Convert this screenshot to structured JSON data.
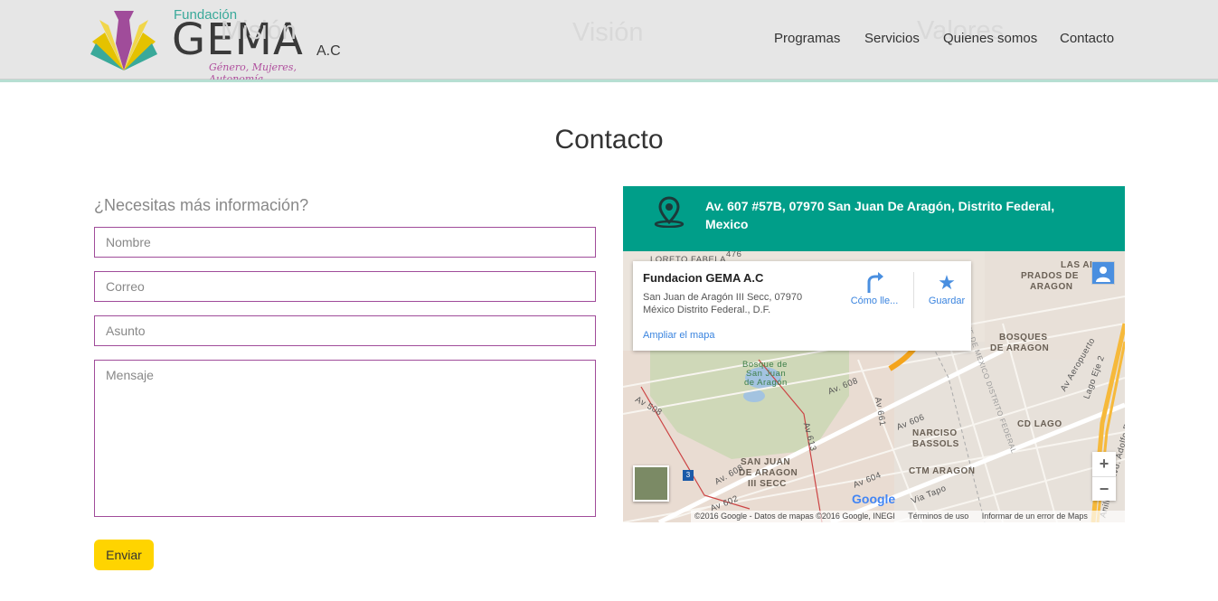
{
  "logo": {
    "small": "Fundación",
    "big": "GEMA",
    "ac": "A.C",
    "tagline": "Género, Mujeres, Autonomía"
  },
  "ghost": {
    "mision": "Misión",
    "vision": "Visión",
    "valores": "Valores"
  },
  "nav": [
    "Programas",
    "Servicios",
    "Quienes somos",
    "Contacto"
  ],
  "page_title": "Contacto",
  "form": {
    "heading": "¿Necesitas más información?",
    "name_placeholder": "Nombre",
    "email_placeholder": "Correo",
    "subject_placeholder": "Asunto",
    "message_placeholder": "Mensaje",
    "submit_label": "Enviar"
  },
  "contact": {
    "address": "Av. 607 #57B, 07970 San Juan De Aragón, Distrito Federal, Mexico"
  },
  "map": {
    "infobox_title": "Fundacion GEMA A.C",
    "infobox_addr1": "San Juan de Aragón III Secc, 07970",
    "infobox_addr2": "México Distrito Federal., D.F.",
    "directions_label": "Cómo lle...",
    "save_label": "Guardar",
    "enlarge_label": "Ampliar el mapa",
    "google": "Google",
    "attribution": "©2016 Google - Datos de mapas ©2016 Google, INEGI",
    "terms": "Términos de uso",
    "report": "Informar de un error de Maps",
    "zoom_in": "+",
    "zoom_out": "−",
    "labels": {
      "prados": "PRADOS DE",
      "aragon1": "ARAGON",
      "las_ar": "LAS AR",
      "bosques1": "BOSQUES",
      "bosques2": "DE ARAGON",
      "cd_lago": "CD LAGO",
      "narciso1": "NARCISO",
      "narciso2": "BASSOLS",
      "ctm": "CTM ARAGON",
      "sja1": "SAN JUAN",
      "sja2": "DE ARAGON",
      "sja3": "III SECC",
      "bosque_park1": "Bosque de",
      "bosque_park2": "San Juan",
      "bosque_park3": "de Aragón",
      "av608": "Av. 608",
      "av606": "Av 606",
      "av604": "Av 604",
      "av602": "Av 602",
      "av508": "Av 508",
      "via_tapo": "Via Tapo",
      "av476": "476",
      "loreto": "LORETO FABELA",
      "av661": "Av 661",
      "av613": "Av 613",
      "av608b": "Av. 608",
      "aeropuerto": "Av Aeropuerto",
      "lago_eje2": "Lago Eje 2",
      "ruiz": "Anillo P. Blvd. Adolfo Ruiz Cortines",
      "distrito": "LIMITE DE MEXICO DISTRITO FEDERAL",
      "route3": "3"
    }
  },
  "colors": {
    "accent_green": "#009e89",
    "button_yellow": "#ffd400",
    "field_border": "#a04c9a"
  }
}
